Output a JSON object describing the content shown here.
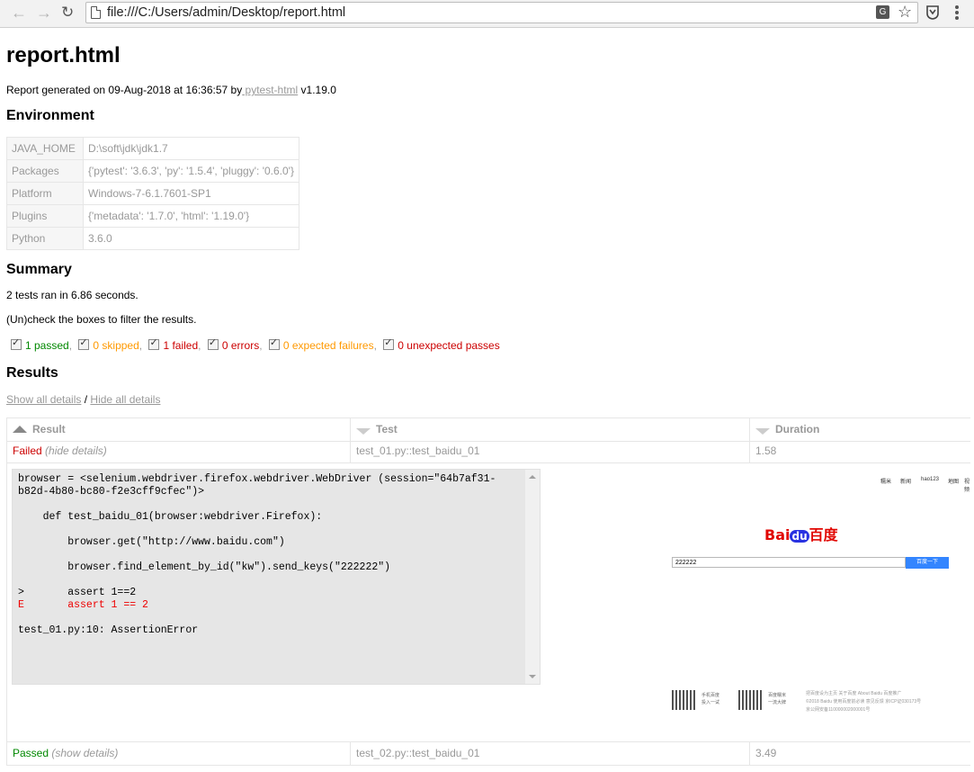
{
  "browser": {
    "url": "file:///C:/Users/admin/Desktop/report.html",
    "back_glyph": "←",
    "forward_glyph": "→",
    "reload_glyph": "↻",
    "star_glyph": "☆",
    "translate_glyph": "G"
  },
  "report": {
    "title": "report.html",
    "generated_prefix": "Report generated on 09-Aug-2018 at 16:36:57 by",
    "generator_link": " pytest-html",
    "generator_version": " v1.19.0"
  },
  "environment": {
    "heading": "Environment",
    "rows": [
      {
        "key": "JAVA_HOME",
        "value": "D:\\soft\\jdk\\jdk1.7"
      },
      {
        "key": "Packages",
        "value": "{'pytest': '3.6.3', 'py': '1.5.4', 'pluggy': '0.6.0'}"
      },
      {
        "key": "Platform",
        "value": "Windows-7-6.1.7601-SP1"
      },
      {
        "key": "Plugins",
        "value": "{'metadata': '1.7.0', 'html': '1.19.0'}"
      },
      {
        "key": "Python",
        "value": "3.6.0"
      }
    ]
  },
  "summary": {
    "heading": "Summary",
    "line1": "2 tests ran in 6.86 seconds.",
    "line2": "(Un)check the boxes to filter the results.",
    "filters": [
      {
        "label": "1 passed",
        "kind": "pass"
      },
      {
        "label": "0 skipped",
        "kind": "skip"
      },
      {
        "label": "1 failed",
        "kind": "fail"
      },
      {
        "label": "0 errors",
        "kind": "fail"
      },
      {
        "label": "0 expected failures",
        "kind": "skip"
      },
      {
        "label": "0 unexpected passes",
        "kind": "fail"
      }
    ],
    "separator": ","
  },
  "results": {
    "heading": "Results",
    "show_all": "Show all details",
    "divider": " / ",
    "hide_all": "Hide all details",
    "columns": {
      "result": "Result",
      "test": "Test",
      "duration": "Duration"
    },
    "rows": [
      {
        "result": "Failed",
        "toggle": "(hide details)",
        "test": "test_01.py::test_baidu_01",
        "duration": "1.58"
      },
      {
        "result": "Passed",
        "toggle": "(show details)",
        "test": "test_02.py::test_baidu_01",
        "duration": "3.49"
      }
    ],
    "log": {
      "l1": "browser = <selenium.webdriver.firefox.webdriver.WebDriver (session=\"64b7af31-",
      "l2": "b82d-4b80-bc80-f2e3cff9cfec\")>",
      "l3": "    def test_baidu_01(browser:webdriver.Firefox):",
      "l4": "        browser.get(\"http://www.baidu.com\")",
      "l5": "        browser.find_element_by_id(\"kw\").send_keys(\"222222\")",
      "l6": ">       assert 1==2",
      "l7": "E       assert 1 == 2",
      "l8": "test_01.py:10: AssertionError"
    },
    "screenshot": {
      "nav": [
        "新闻",
        "hao123",
        "地图",
        "视频"
      ],
      "nav0": "糯米",
      "logo_bai": "Bai",
      "logo_du": "du",
      "logo_cn": "百度",
      "search_value": "222222",
      "search_button": "百度一下",
      "qr1": "手机百度",
      "qr1b": "投入一试",
      "qr2": "百度糯米",
      "qr2b": "一流大牌",
      "foot1": "把百度设为主页     关于百度     About  Baidu     百度推广",
      "foot2": "©2018 Baidu 使用百度前必读 意见反馈 京ICP证030173号",
      "foot3": "京公网安备110000002000001号"
    }
  }
}
